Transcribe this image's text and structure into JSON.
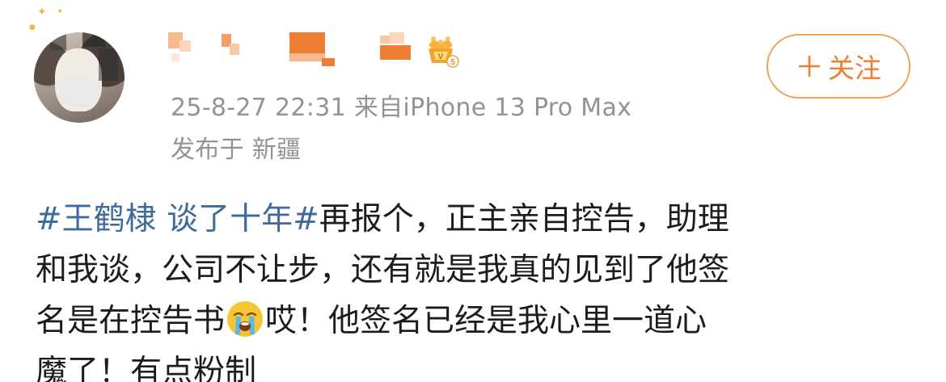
{
  "post": {
    "timestamp": "25-8-27 22:31",
    "source": "来自iPhone 13 Pro Max",
    "location": "发布于 新疆",
    "follow_button": {
      "icon": "plus-icon",
      "label": "关注"
    },
    "body": {
      "hashtag": "#王鹤棣 谈了十年#",
      "line1_text": "再报个，正主亲自控告，助理",
      "line2": "和我谈，公司不让步，还有就是我真的见到了他签",
      "line3_before_emoji": "名是在控告书",
      "emoji": "crying-face-emoji",
      "line3_after_emoji": "哎！他签名已经是我心里一道心",
      "line4": "魔了！有点粉制"
    },
    "author": {
      "avatar": "avatar-pixelated",
      "name": "pixelated-username",
      "badge": "vip-crown-badge-level-5"
    },
    "colors": {
      "accent_orange": "#ee7f31",
      "hashtag_blue": "#3f6b9c",
      "meta_gray": "#939393"
    }
  }
}
